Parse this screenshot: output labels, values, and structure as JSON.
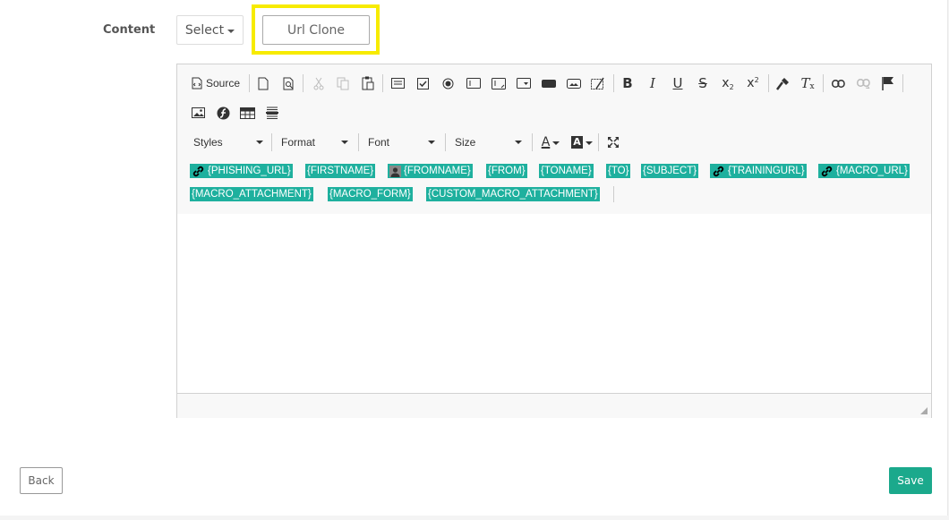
{
  "form": {
    "content_label": "Content",
    "select_label": "Select",
    "url_clone_label": "Url Clone"
  },
  "toolbar": {
    "source_label": "Source",
    "styles_label": "Styles",
    "format_label": "Format",
    "font_label": "Font",
    "size_label": "Size"
  },
  "placeholders": [
    "{PHISHING_URL}",
    "{FIRSTNAME}",
    "{FROMNAME}",
    "{FROM}",
    "{TONAME}",
    "{TO}",
    "{SUBJECT}",
    "{TRAININGURL}",
    "{MACRO_URL}",
    "{MACRO_ATTACHMENT}",
    "{MACRO_FORM}",
    "{CUSTOM_MACRO_ATTACHMENT}"
  ],
  "actions": {
    "back_label": "Back",
    "save_label": "Save"
  },
  "colors": {
    "tag_bg": "#1eb09e",
    "save_bg": "#1ba98c",
    "highlight": "#f7eb00"
  }
}
